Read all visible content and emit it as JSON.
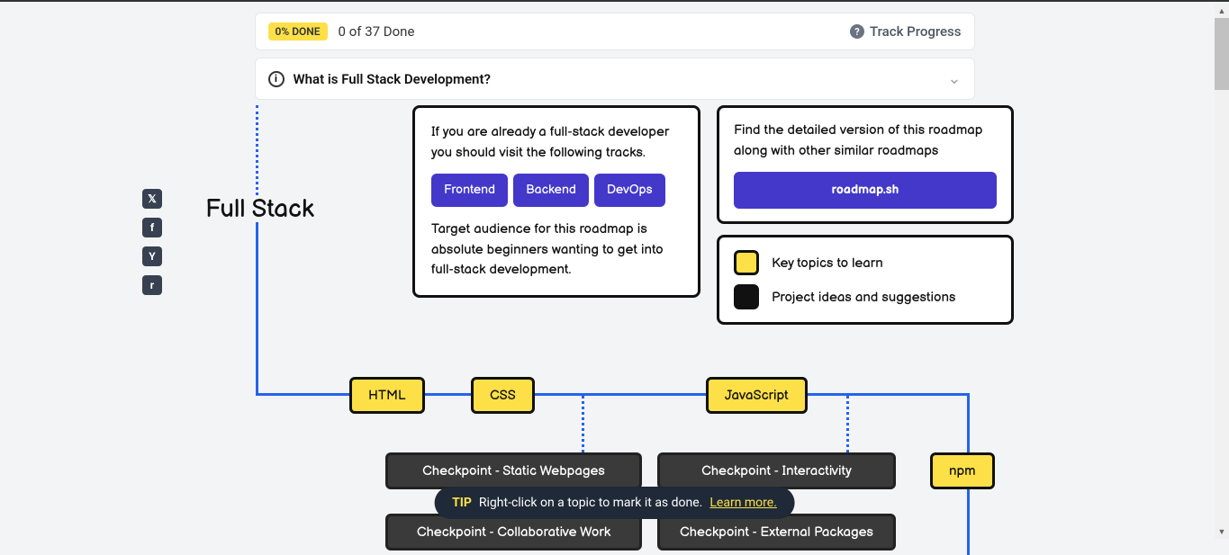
{
  "progress": {
    "badge": "0% DONE",
    "text": "0 of 37 Done",
    "track_label": "Track Progress"
  },
  "accordion": {
    "title": "What is Full Stack Development?"
  },
  "title": "Full Stack",
  "box1": {
    "text1": "If you are already a full-stack developer you should visit the following tracks.",
    "text2": "Target audience for this roadmap is absolute beginners wanting to get into full-stack development.",
    "buttons": {
      "frontend": "Frontend",
      "backend": "Backend",
      "devops": "DevOps"
    }
  },
  "box2": {
    "text": "Find the detailed version of this roadmap along with other similar roadmaps",
    "button": "roadmap.sh"
  },
  "legend": {
    "yellow": "Key topics to learn",
    "black": "Project ideas and suggestions"
  },
  "nodes": {
    "html": "HTML",
    "css": "CSS",
    "javascript": "JavaScript",
    "npm": "npm",
    "checkpoint1": "Checkpoint - Static Webpages",
    "checkpoint2": "Checkpoint - Interactivity",
    "checkpoint3": "Checkpoint - Collaborative Work",
    "checkpoint4": "Checkpoint - External Packages"
  },
  "tip": {
    "label": "TIP",
    "text": "Right-click on a topic to mark it as done.",
    "link": "Learn more."
  },
  "social": {
    "x": "𝕏",
    "fb": "f",
    "hn": "Y",
    "reddit": "r"
  }
}
